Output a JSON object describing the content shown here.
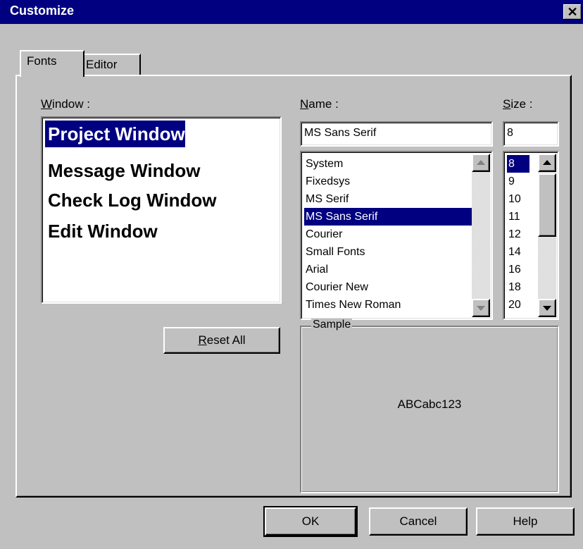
{
  "window": {
    "title": "Customize",
    "close_glyph": "✕"
  },
  "tabs": [
    {
      "label": "Fonts",
      "selected": true
    },
    {
      "label": "Editor",
      "selected": false
    }
  ],
  "window_section": {
    "label_accel": "W",
    "label_rest": "indow :",
    "items": [
      {
        "label": "Project Window",
        "selected": true
      },
      {
        "label": "Message Window",
        "selected": false
      },
      {
        "label": "Check Log Window",
        "selected": false
      },
      {
        "label": "Edit Window",
        "selected": false
      }
    ],
    "reset_accel": "R",
    "reset_rest": "eset All"
  },
  "name_section": {
    "label_accel": "N",
    "label_rest": "ame :",
    "value": "MS Sans Serif",
    "options": [
      {
        "label": "System",
        "selected": false
      },
      {
        "label": "Fixedsys",
        "selected": false
      },
      {
        "label": "MS Serif",
        "selected": false
      },
      {
        "label": "MS Sans Serif",
        "selected": true
      },
      {
        "label": "Courier",
        "selected": false
      },
      {
        "label": "Small Fonts",
        "selected": false
      },
      {
        "label": "Arial",
        "selected": false
      },
      {
        "label": "Courier New",
        "selected": false
      },
      {
        "label": "Times New Roman",
        "selected": false
      }
    ]
  },
  "size_section": {
    "label_accel": "S",
    "label_rest": "ize :",
    "value": "8",
    "options": [
      {
        "label": "8",
        "selected": true
      },
      {
        "label": "9",
        "selected": false
      },
      {
        "label": "10",
        "selected": false
      },
      {
        "label": "11",
        "selected": false
      },
      {
        "label": "12",
        "selected": false
      },
      {
        "label": "14",
        "selected": false
      },
      {
        "label": "16",
        "selected": false
      },
      {
        "label": "18",
        "selected": false
      },
      {
        "label": "20",
        "selected": false
      }
    ]
  },
  "sample": {
    "label": "Sample",
    "text": "ABCabc123"
  },
  "buttons": {
    "ok": "OK",
    "cancel": "Cancel",
    "help": "Help"
  },
  "icons": {
    "close": "close-icon",
    "scroll_up": "arrow-up-icon",
    "scroll_down": "arrow-down-icon"
  },
  "colors": {
    "face": "#c0c0c0",
    "title_bar": "#000080",
    "selection": "#000080",
    "selection_text": "#ffffff"
  }
}
